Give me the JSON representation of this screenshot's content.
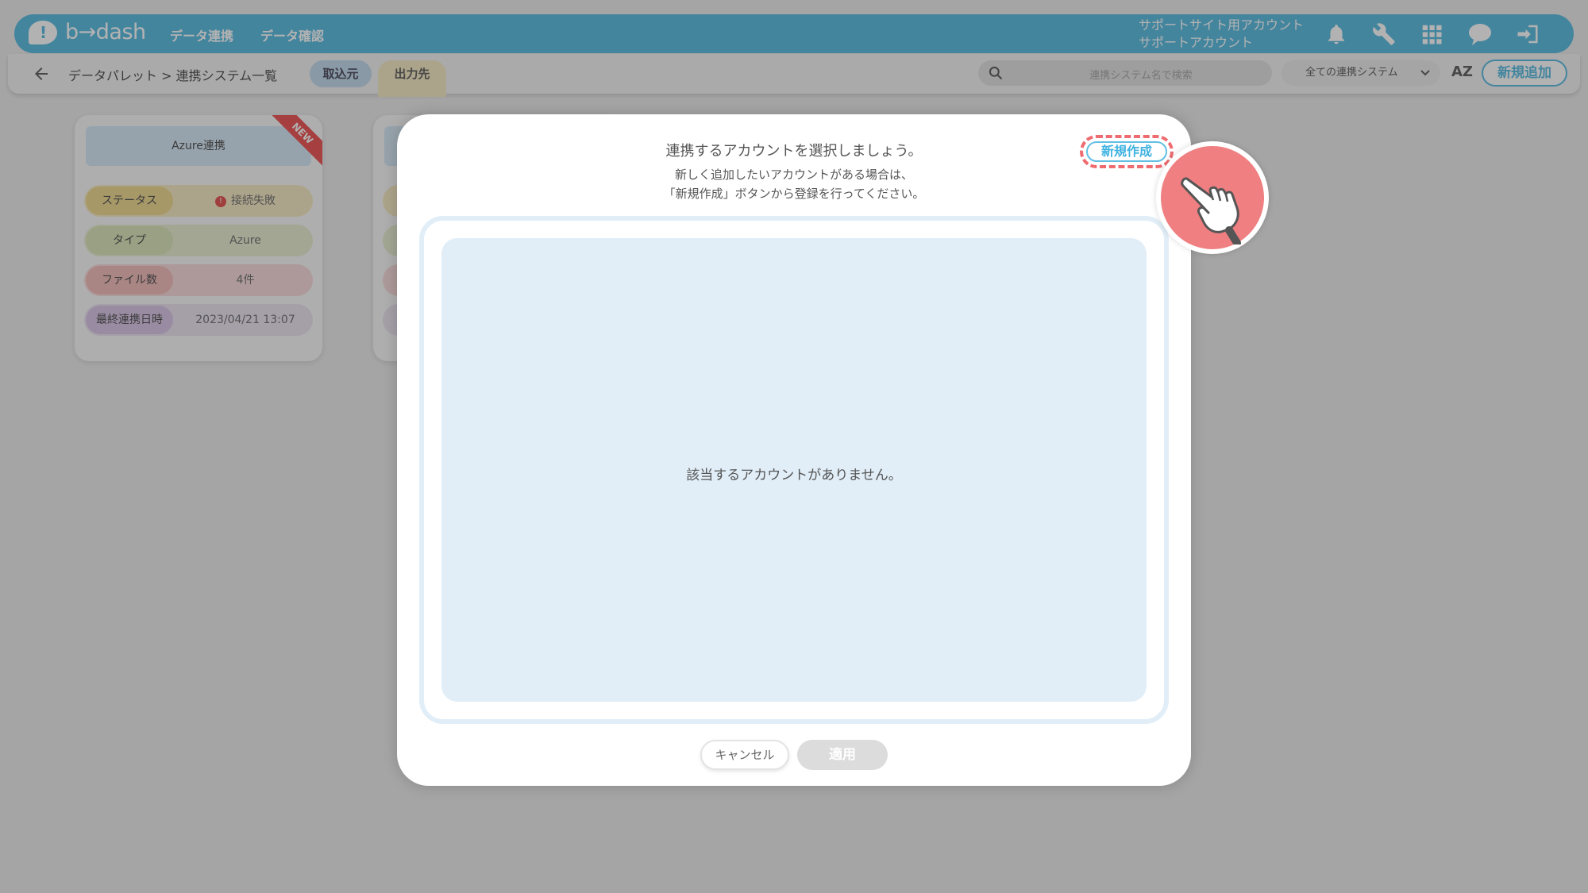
{
  "header": {
    "logo_text": "b→dash",
    "nav": [
      "データ連携",
      "データ確認"
    ],
    "account_line1": "サポートサイト用アカウント",
    "account_line2": "サポートアカウント",
    "icons": [
      "bell-icon",
      "wrench-icon",
      "grid-icon",
      "chat-icon",
      "logout-icon"
    ]
  },
  "subheader": {
    "breadcrumb": "データパレット > 連携システム一覧",
    "tab_import": "取込元",
    "tab_output": "出力先",
    "search_placeholder": "連携システム名で検索",
    "filter_value": "全ての連携システム",
    "sort_label": "AZ",
    "add_button": "新規追加"
  },
  "card": {
    "title": "Azure連携",
    "ribbon": "NEW",
    "rows": [
      {
        "label": "ステータス",
        "value": "接続失敗"
      },
      {
        "label": "タイプ",
        "value": "Azure"
      },
      {
        "label": "ファイル数",
        "value": "4件"
      },
      {
        "label": "最終連携日時",
        "value": "2023/04/21 13:07"
      }
    ]
  },
  "modal": {
    "title": "連携するアカウントを選択しましょう。",
    "desc_line1": "新しく追加したいアカウントがある場合は、",
    "desc_line2": "「新規作成」ボタンから登録を行ってください。",
    "create_button": "新規作成",
    "empty_message": "該当するアカウントがありません。",
    "cancel_button": "キャンセル",
    "apply_button": "適用"
  },
  "colors": {
    "accent": "#62bfe3",
    "highlight": "#ee6b70",
    "list_bg": "#e1eef8"
  }
}
